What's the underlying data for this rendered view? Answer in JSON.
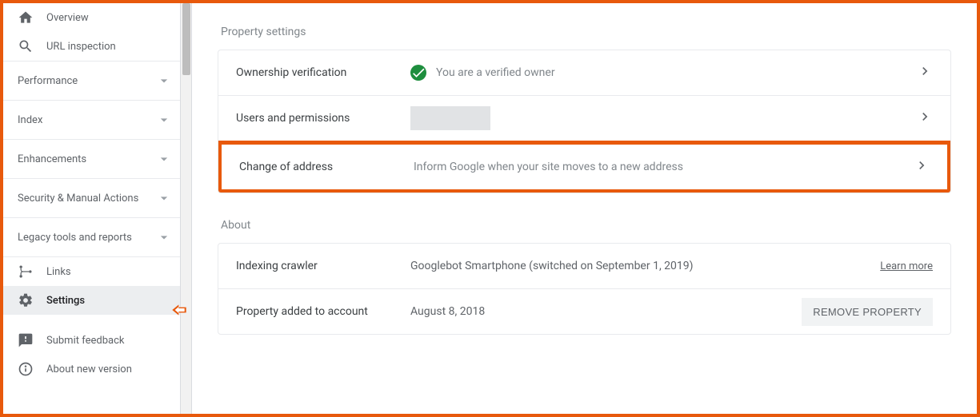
{
  "sidebar": {
    "items_top": [
      {
        "label": "Overview",
        "icon": "home-icon"
      },
      {
        "label": "URL inspection",
        "icon": "search-icon"
      }
    ],
    "sections": [
      {
        "label": "Performance"
      },
      {
        "label": "Index"
      },
      {
        "label": "Enhancements"
      },
      {
        "label": "Security & Manual Actions"
      },
      {
        "label": "Legacy tools and reports"
      }
    ],
    "items_bottom": [
      {
        "label": "Links",
        "icon": "links-icon",
        "selected": false
      },
      {
        "label": "Settings",
        "icon": "gear-icon",
        "selected": true
      },
      {
        "label": "Submit feedback",
        "icon": "feedback-icon",
        "selected": false
      },
      {
        "label": "About new version",
        "icon": "info-icon",
        "selected": false
      }
    ]
  },
  "main": {
    "property_settings_title": "Property settings",
    "rows": {
      "ownership": {
        "label": "Ownership verification",
        "status": "You are a verified owner"
      },
      "users": {
        "label": "Users and permissions"
      },
      "change_address": {
        "label": "Change of address",
        "hint": "Inform Google when your site moves to a new address"
      }
    },
    "about_title": "About",
    "about": {
      "crawler": {
        "label": "Indexing crawler",
        "value": "Googlebot Smartphone (switched on September 1, 2019)",
        "learn_more": "Learn more"
      },
      "added": {
        "label": "Property added to account",
        "value": "August 8, 2018",
        "remove": "REMOVE PROPERTY"
      }
    }
  }
}
